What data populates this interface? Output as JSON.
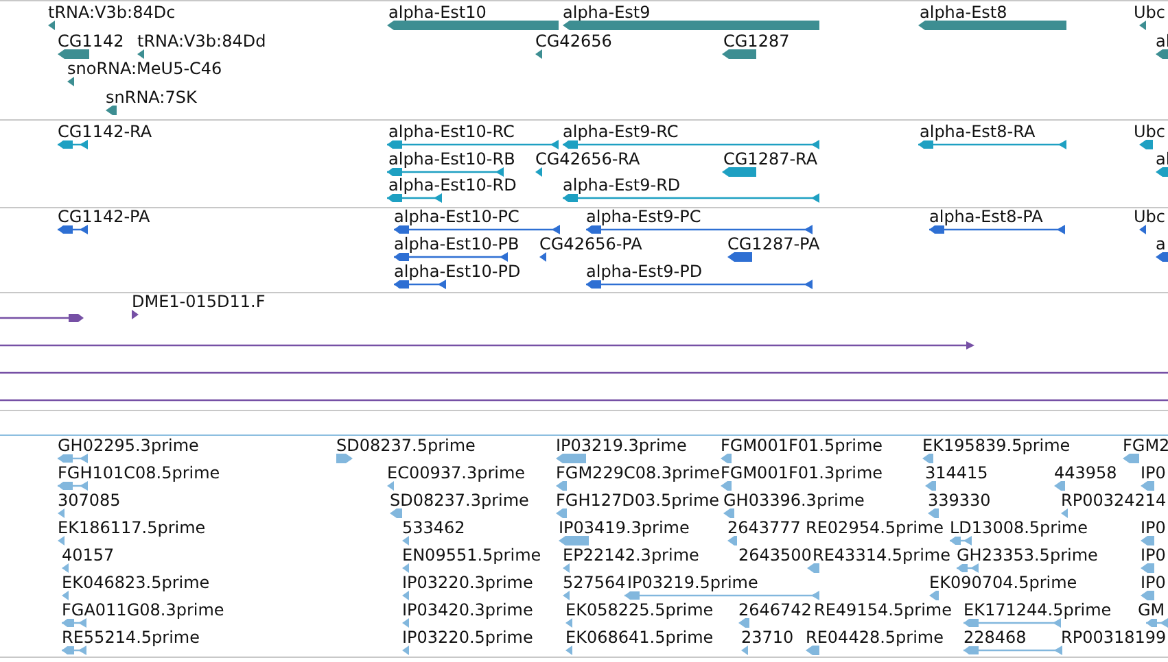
{
  "tracks": [
    {
      "kind": "gene",
      "features": [
        {
          "label": "tRNA:V3b:84Dc"
        },
        {
          "label": "alpha-Est10"
        },
        {
          "label": "alpha-Est9"
        },
        {
          "label": "alpha-Est8"
        },
        {
          "label": "Ubc"
        },
        {
          "label": "CG1142"
        },
        {
          "label": "tRNA:V3b:84Dd"
        },
        {
          "label": "CG42656"
        },
        {
          "label": "CG1287"
        },
        {
          "label": "al"
        },
        {
          "label": "snoRNA:MeU5-C46"
        },
        {
          "label": "snRNA:7SK"
        }
      ]
    },
    {
      "kind": "transcript",
      "features": [
        {
          "label": "CG1142-RA"
        },
        {
          "label": "alpha-Est10-RC"
        },
        {
          "label": "alpha-Est9-RC"
        },
        {
          "label": "alpha-Est8-RA"
        },
        {
          "label": "Ubc"
        },
        {
          "label": "alpha-Est10-RB"
        },
        {
          "label": "CG42656-RA"
        },
        {
          "label": "CG1287-RA"
        },
        {
          "label": "al"
        },
        {
          "label": "alpha-Est10-RD"
        },
        {
          "label": "alpha-Est9-RD"
        }
      ]
    },
    {
      "kind": "protein",
      "features": [
        {
          "label": "CG1142-PA"
        },
        {
          "label": "alpha-Est10-PC"
        },
        {
          "label": "alpha-Est9-PC"
        },
        {
          "label": "alpha-Est8-PA"
        },
        {
          "label": "Ubc"
        },
        {
          "label": "alpha-Est10-PB"
        },
        {
          "label": "CG42656-PA"
        },
        {
          "label": "CG1287-PA"
        },
        {
          "label": "a"
        },
        {
          "label": "alpha-Est10-PD"
        },
        {
          "label": "alpha-Est9-PD"
        }
      ]
    },
    {
      "kind": "alignment",
      "features": [
        {
          "label": "DME1-015D11.F"
        }
      ]
    },
    {
      "kind": "est",
      "features": [
        {
          "label": "GH02295.3prime"
        },
        {
          "label": "SD08237.5prime"
        },
        {
          "label": "IP03219.3prime"
        },
        {
          "label": "FGM001F01.5prime"
        },
        {
          "label": "EK195839.5prime"
        },
        {
          "label": "FGM2"
        },
        {
          "label": "FGH101C08.5prime"
        },
        {
          "label": "EC00937.3prime"
        },
        {
          "label": "FGM229C08.3prime"
        },
        {
          "label": "FGM001F01.3prime"
        },
        {
          "label": "314415"
        },
        {
          "label": "443958"
        },
        {
          "label": "IP0"
        },
        {
          "label": "307085"
        },
        {
          "label": "SD08237.3prime"
        },
        {
          "label": "FGH127D03.5prime"
        },
        {
          "label": "GH03396.3prime"
        },
        {
          "label": "339330"
        },
        {
          "label": "RP00324214"
        },
        {
          "label": "EK186117.5prime"
        },
        {
          "label": "533462"
        },
        {
          "label": "IP03419.3prime"
        },
        {
          "label": "2643777"
        },
        {
          "label": "RE02954.5prime"
        },
        {
          "label": "LD13008.5prime"
        },
        {
          "label": "IP0"
        },
        {
          "label": "40157"
        },
        {
          "label": "EN09551.5prime"
        },
        {
          "label": "EP22142.3prime"
        },
        {
          "label": "2643500"
        },
        {
          "label": "RE43314.5prime"
        },
        {
          "label": "GH23353.5prime"
        },
        {
          "label": "IP0"
        },
        {
          "label": "EK046823.5prime"
        },
        {
          "label": "IP03220.3prime"
        },
        {
          "label": "527564"
        },
        {
          "label": "IP03219.5prime"
        },
        {
          "label": "EK090704.5prime"
        },
        {
          "label": "IP0"
        },
        {
          "label": "FGA011G08.3prime"
        },
        {
          "label": "IP03420.3prime"
        },
        {
          "label": "EK058225.5prime"
        },
        {
          "label": "2646742"
        },
        {
          "label": "RE49154.5prime"
        },
        {
          "label": "EK171244.5prime"
        },
        {
          "label": "GM"
        },
        {
          "label": "RE55214.5prime"
        },
        {
          "label": "IP03220.5prime"
        },
        {
          "label": "EK068641.5prime"
        },
        {
          "label": "23710"
        },
        {
          "label": "RE04428.5prime"
        },
        {
          "label": "228468"
        },
        {
          "label": "RP00318199"
        }
      ]
    }
  ]
}
